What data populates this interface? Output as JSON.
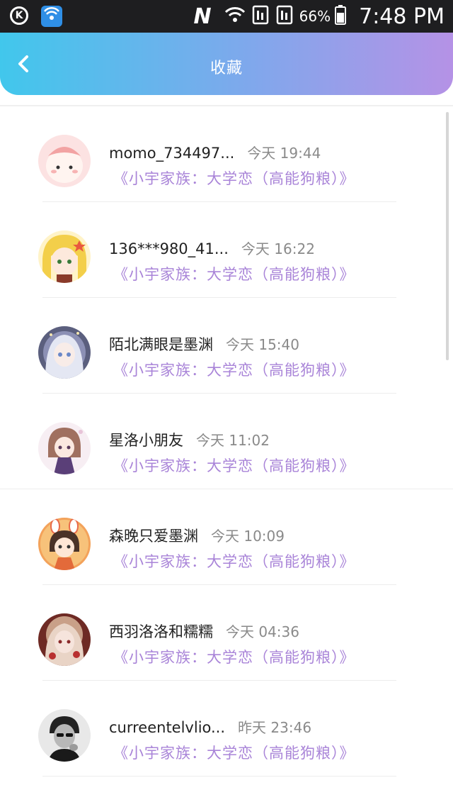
{
  "status_bar": {
    "battery_percent": "66%",
    "time": "7:48 PM"
  },
  "header": {
    "title": "收藏"
  },
  "favorites": [
    {
      "name": "momo_734497...",
      "time": "今天 19:44",
      "snippet": "《小宇家族：大学恋（高能狗粮）》",
      "avatar": "pink-cartoon-avatar"
    },
    {
      "name": "136***980_41...",
      "time": "今天 16:22",
      "snippet": "《小宇家族：大学恋（高能狗粮）》",
      "avatar": "blonde-anime-avatar"
    },
    {
      "name": "陌北满眼是墨渊",
      "time": "今天 15:40",
      "snippet": "《小宇家族：大学恋（高能狗粮）》",
      "avatar": "white-hair-anime-avatar"
    },
    {
      "name": "星洛小朋友",
      "time": "今天 11:02",
      "snippet": "《小宇家族：大学恋（高能狗粮）》",
      "avatar": "doll-anime-avatar"
    },
    {
      "name": "森晚只爱墨渊",
      "time": "今天 10:09",
      "snippet": "《小宇家族：大学恋（高能狗粮）》",
      "avatar": "chibi-bunny-avatar"
    },
    {
      "name": "西羽洛洛和糯糯",
      "time": "今天 04:36",
      "snippet": "《小宇家族：大学恋（高能狗粮）》",
      "avatar": "red-anime-avatar"
    },
    {
      "name": "curreentelvlio...",
      "time": "昨天 23:46",
      "snippet": "《小宇家族：大学恋（高能狗粮）》",
      "avatar": "bw-photo-avatar"
    }
  ],
  "colors": {
    "header_gradient_start": "#41c7ec",
    "header_gradient_end": "#b592e6",
    "snippet": "#a984d8"
  }
}
